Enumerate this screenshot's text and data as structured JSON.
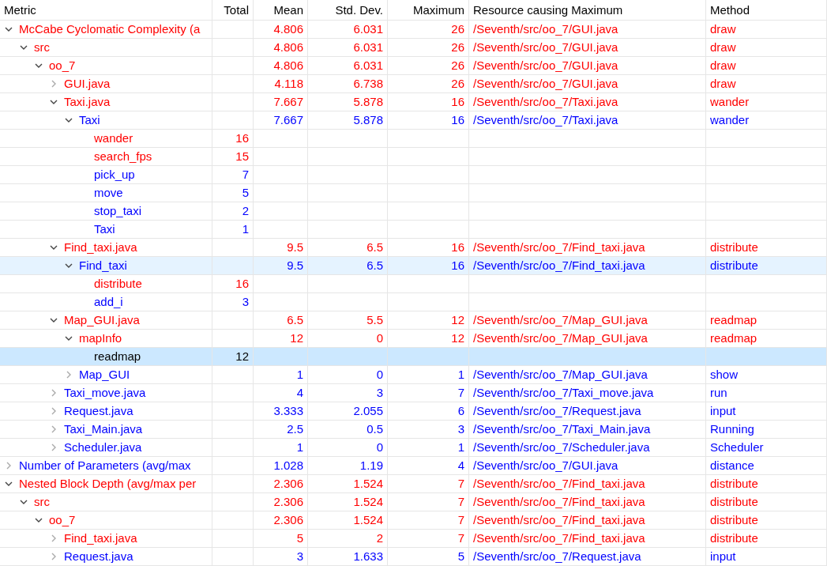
{
  "table": {
    "columns": [
      "Metric",
      "Total",
      "Mean",
      "Std. Dev.",
      "Maximum",
      "Resource causing Maximum",
      "Method"
    ],
    "rows": [
      {
        "metric": "McCabe Cyclomatic Complexity (a",
        "mean": "4.806",
        "std_dev": "6.031",
        "maximum": "26",
        "resource": "/Seventh/src/oo_7/GUI.java",
        "method": "draw",
        "color": "#ff0000",
        "expanded": true,
        "selected": false,
        "hovered": false,
        "children": [
          {
            "metric": "src",
            "mean": "4.806",
            "std_dev": "6.031",
            "maximum": "26",
            "resource": "/Seventh/src/oo_7/GUI.java",
            "method": "draw",
            "color": "#ff0000",
            "expanded": true,
            "selected": false,
            "hovered": false,
            "children": [
              {
                "metric": "oo_7",
                "mean": "4.806",
                "std_dev": "6.031",
                "maximum": "26",
                "resource": "/Seventh/src/oo_7/GUI.java",
                "method": "draw",
                "color": "#ff0000",
                "expanded": true,
                "selected": false,
                "hovered": false,
                "children": [
                  {
                    "metric": "GUI.java",
                    "mean": "4.118",
                    "std_dev": "6.738",
                    "maximum": "26",
                    "resource": "/Seventh/src/oo_7/GUI.java",
                    "method": "draw",
                    "color": "#ff0000",
                    "expanded": false,
                    "selected": false,
                    "hovered": false
                  },
                  {
                    "metric": "Taxi.java",
                    "mean": "7.667",
                    "std_dev": "5.878",
                    "maximum": "16",
                    "resource": "/Seventh/src/oo_7/Taxi.java",
                    "method": "wander",
                    "color": "#ff0000",
                    "expanded": true,
                    "selected": false,
                    "hovered": false,
                    "children": [
                      {
                        "metric": "Taxi",
                        "mean": "7.667",
                        "std_dev": "5.878",
                        "maximum": "16",
                        "resource": "/Seventh/src/oo_7/Taxi.java",
                        "method": "wander",
                        "color": "#0000ff",
                        "expanded": true,
                        "selected": false,
                        "hovered": false,
                        "children": [
                          {
                            "metric": "wander",
                            "total": "16",
                            "color": "#ff0000",
                            "selected": false,
                            "hovered": false
                          },
                          {
                            "metric": "search_fps",
                            "total": "15",
                            "color": "#ff0000",
                            "selected": false,
                            "hovered": false
                          },
                          {
                            "metric": "pick_up",
                            "total": "7",
                            "color": "#0000ff",
                            "selected": false,
                            "hovered": false
                          },
                          {
                            "metric": "move",
                            "total": "5",
                            "color": "#0000ff",
                            "selected": false,
                            "hovered": false
                          },
                          {
                            "metric": "stop_taxi",
                            "total": "2",
                            "color": "#0000ff",
                            "selected": false,
                            "hovered": false
                          },
                          {
                            "metric": "Taxi",
                            "total": "1",
                            "color": "#0000ff",
                            "selected": false,
                            "hovered": false
                          }
                        ]
                      }
                    ]
                  },
                  {
                    "metric": "Find_taxi.java",
                    "mean": "9.5",
                    "std_dev": "6.5",
                    "maximum": "16",
                    "resource": "/Seventh/src/oo_7/Find_taxi.java",
                    "method": "distribute",
                    "color": "#ff0000",
                    "expanded": true,
                    "selected": false,
                    "hovered": false,
                    "children": [
                      {
                        "metric": "Find_taxi",
                        "mean": "9.5",
                        "std_dev": "6.5",
                        "maximum": "16",
                        "resource": "/Seventh/src/oo_7/Find_taxi.java",
                        "method": "distribute",
                        "color": "#0000ff",
                        "expanded": true,
                        "selected": false,
                        "hovered": true,
                        "children": [
                          {
                            "metric": "distribute",
                            "total": "16",
                            "color": "#ff0000",
                            "selected": false,
                            "hovered": false
                          },
                          {
                            "metric": "add_i",
                            "total": "3",
                            "color": "#0000ff",
                            "selected": false,
                            "hovered": false
                          }
                        ]
                      }
                    ]
                  },
                  {
                    "metric": "Map_GUI.java",
                    "mean": "6.5",
                    "std_dev": "5.5",
                    "maximum": "12",
                    "resource": "/Seventh/src/oo_7/Map_GUI.java",
                    "method": "readmap",
                    "color": "#ff0000",
                    "expanded": true,
                    "selected": false,
                    "hovered": false,
                    "children": [
                      {
                        "metric": "mapInfo",
                        "mean": "12",
                        "std_dev": "0",
                        "maximum": "12",
                        "resource": "/Seventh/src/oo_7/Map_GUI.java",
                        "method": "readmap",
                        "color": "#ff0000",
                        "expanded": true,
                        "selected": false,
                        "hovered": false,
                        "children": [
                          {
                            "metric": "readmap",
                            "total": "12",
                            "color": "#000000",
                            "selected": true,
                            "hovered": false
                          }
                        ]
                      },
                      {
                        "metric": "Map_GUI",
                        "mean": "1",
                        "std_dev": "0",
                        "maximum": "1",
                        "resource": "/Seventh/src/oo_7/Map_GUI.java",
                        "method": "show",
                        "color": "#0000ff",
                        "expanded": false,
                        "selected": false,
                        "hovered": false
                      }
                    ]
                  },
                  {
                    "metric": "Taxi_move.java",
                    "mean": "4",
                    "std_dev": "3",
                    "maximum": "7",
                    "resource": "/Seventh/src/oo_7/Taxi_move.java",
                    "method": "run",
                    "color": "#0000ff",
                    "expanded": false,
                    "selected": false,
                    "hovered": false
                  },
                  {
                    "metric": "Request.java",
                    "mean": "3.333",
                    "std_dev": "2.055",
                    "maximum": "6",
                    "resource": "/Seventh/src/oo_7/Request.java",
                    "method": "input",
                    "color": "#0000ff",
                    "expanded": false,
                    "selected": false,
                    "hovered": false
                  },
                  {
                    "metric": "Taxi_Main.java",
                    "mean": "2.5",
                    "std_dev": "0.5",
                    "maximum": "3",
                    "resource": "/Seventh/src/oo_7/Taxi_Main.java",
                    "method": "Running",
                    "color": "#0000ff",
                    "expanded": false,
                    "selected": false,
                    "hovered": false
                  },
                  {
                    "metric": "Scheduler.java",
                    "mean": "1",
                    "std_dev": "0",
                    "maximum": "1",
                    "resource": "/Seventh/src/oo_7/Scheduler.java",
                    "method": "Scheduler",
                    "color": "#0000ff",
                    "expanded": false,
                    "selected": false,
                    "hovered": false
                  }
                ]
              }
            ]
          }
        ]
      },
      {
        "metric": "Number of Parameters (avg/max",
        "mean": "1.028",
        "std_dev": "1.19",
        "maximum": "4",
        "resource": "/Seventh/src/oo_7/GUI.java",
        "method": "distance",
        "color": "#0000ff",
        "expanded": false,
        "selected": false,
        "hovered": false
      },
      {
        "metric": "Nested Block Depth (avg/max per",
        "mean": "2.306",
        "std_dev": "1.524",
        "maximum": "7",
        "resource": "/Seventh/src/oo_7/Find_taxi.java",
        "method": "distribute",
        "color": "#ff0000",
        "expanded": true,
        "selected": false,
        "hovered": false,
        "children": [
          {
            "metric": "src",
            "mean": "2.306",
            "std_dev": "1.524",
            "maximum": "7",
            "resource": "/Seventh/src/oo_7/Find_taxi.java",
            "method": "distribute",
            "color": "#ff0000",
            "expanded": true,
            "selected": false,
            "hovered": false,
            "children": [
              {
                "metric": "oo_7",
                "mean": "2.306",
                "std_dev": "1.524",
                "maximum": "7",
                "resource": "/Seventh/src/oo_7/Find_taxi.java",
                "method": "distribute",
                "color": "#ff0000",
                "expanded": true,
                "selected": false,
                "hovered": false,
                "children": [
                  {
                    "metric": "Find_taxi.java",
                    "mean": "5",
                    "std_dev": "2",
                    "maximum": "7",
                    "resource": "/Seventh/src/oo_7/Find_taxi.java",
                    "method": "distribute",
                    "color": "#ff0000",
                    "expanded": false,
                    "selected": false,
                    "hovered": false
                  },
                  {
                    "metric": "Request.java",
                    "mean": "3",
                    "std_dev": "1.633",
                    "maximum": "5",
                    "resource": "/Seventh/src/oo_7/Request.java",
                    "method": "input",
                    "color": "#0000ff",
                    "expanded": false,
                    "selected": false,
                    "hovered": false
                  }
                ]
              }
            ]
          }
        ]
      }
    ]
  }
}
